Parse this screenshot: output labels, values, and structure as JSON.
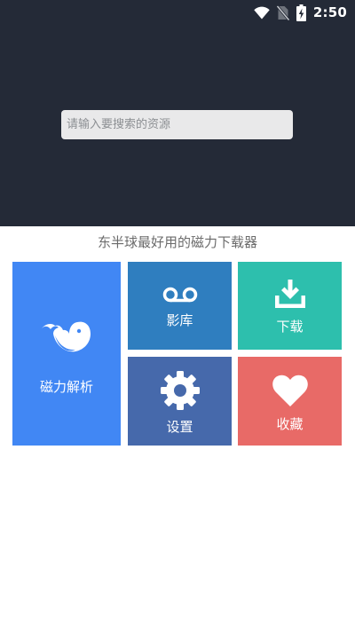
{
  "status_bar": {
    "time": "2:50",
    "icons": [
      "wifi-icon",
      "no-sim-icon",
      "battery-charging-icon"
    ]
  },
  "search": {
    "placeholder": "请输入要搜索的资源"
  },
  "slogan": "东半球最好用的磁力下载器",
  "tiles": {
    "magnet": {
      "label": "磁力解析",
      "icon": "whale-icon",
      "color": "#4187f4"
    },
    "library": {
      "label": "影库",
      "icon": "voicemail-icon",
      "color": "#2f7ebf"
    },
    "download": {
      "label": "下载",
      "icon": "download-icon",
      "color": "#2dbfad"
    },
    "settings": {
      "label": "设置",
      "icon": "gear-icon",
      "color": "#4669ab"
    },
    "favorite": {
      "label": "收藏",
      "icon": "heart-icon",
      "color": "#e86a67"
    }
  },
  "colors": {
    "header_background": "#242a37"
  }
}
